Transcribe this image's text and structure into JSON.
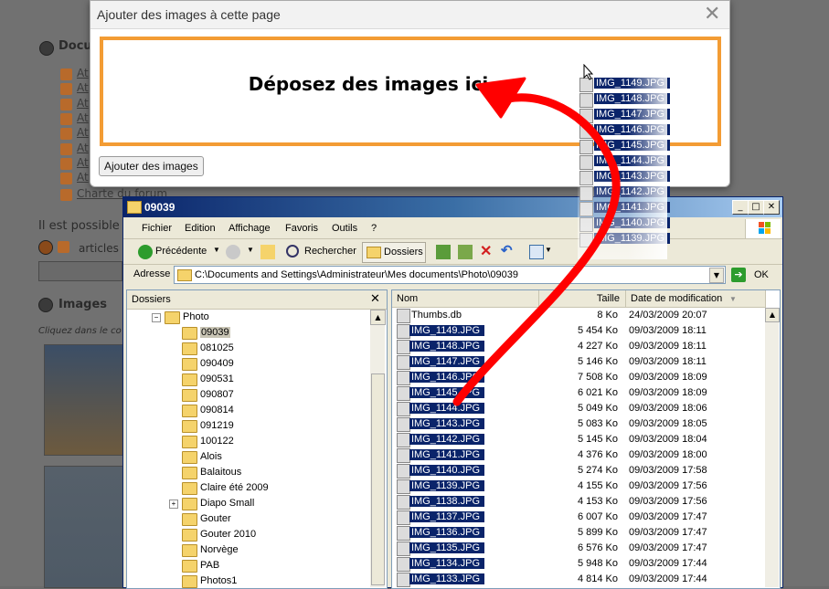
{
  "background": {
    "section_docs": "Docu",
    "doc_link_prefix": "At",
    "charte": "Charte du forum",
    "possible_text": "Il est possible",
    "articles": "articles",
    "images_title": "Images",
    "click_text": "Cliquez dans le co"
  },
  "dialog": {
    "title": "Ajouter des images à cette page",
    "close_glyph": "✕",
    "drop_text": "Déposez des images ici",
    "add_button": "Ajouter des images"
  },
  "explorer": {
    "title": "09039",
    "menu": [
      "Fichier",
      "Edition",
      "Affichage",
      "Favoris",
      "Outils",
      "?"
    ],
    "toolbar": {
      "back": "Précédente",
      "search": "Rechercher",
      "folders": "Dossiers"
    },
    "address_label": "Adresse",
    "address_value": "C:\\Documents and Settings\\Administrateur\\Mes documents\\Photo\\09039",
    "go_label": "OK",
    "folders_pane_title": "Dossiers",
    "folders_close": "✕",
    "tree": [
      {
        "label": "Photo",
        "expander": "−"
      },
      {
        "label": "09039",
        "selected": true
      },
      {
        "label": "081025"
      },
      {
        "label": "090409"
      },
      {
        "label": "090531"
      },
      {
        "label": "090807"
      },
      {
        "label": "090814"
      },
      {
        "label": "091219"
      },
      {
        "label": "100122"
      },
      {
        "label": "Alois"
      },
      {
        "label": "Balaitous"
      },
      {
        "label": "Claire été 2009"
      },
      {
        "label": "Diapo Small",
        "expander": "+"
      },
      {
        "label": "Gouter"
      },
      {
        "label": "Gouter 2010"
      },
      {
        "label": "Norvège"
      },
      {
        "label": "PAB"
      },
      {
        "label": "Photos1"
      }
    ],
    "columns": {
      "name": "Nom",
      "size": "Taille",
      "date": "Date de modification"
    },
    "files": [
      {
        "name": "Thumbs.db",
        "size": "8 Ko",
        "date": "24/03/2009 20:07",
        "selected": false
      },
      {
        "name": "IMG_1149.JPG",
        "size": "5 454 Ko",
        "date": "09/03/2009 18:11",
        "selected": true
      },
      {
        "name": "IMG_1148.JPG",
        "size": "4 227 Ko",
        "date": "09/03/2009 18:11",
        "selected": true
      },
      {
        "name": "IMG_1147.JPG",
        "size": "5 146 Ko",
        "date": "09/03/2009 18:11",
        "selected": true
      },
      {
        "name": "IMG_1146.JPG",
        "size": "7 508 Ko",
        "date": "09/03/2009 18:09",
        "selected": true
      },
      {
        "name": "IMG_1145.JPG",
        "size": "6 021 Ko",
        "date": "09/03/2009 18:09",
        "selected": true
      },
      {
        "name": "IMG_1144.JPG",
        "size": "5 049 Ko",
        "date": "09/03/2009 18:06",
        "selected": true
      },
      {
        "name": "IMG_1143.JPG",
        "size": "5 083 Ko",
        "date": "09/03/2009 18:05",
        "selected": true
      },
      {
        "name": "IMG_1142.JPG",
        "size": "5 145 Ko",
        "date": "09/03/2009 18:04",
        "selected": true
      },
      {
        "name": "IMG_1141.JPG",
        "size": "4 376 Ko",
        "date": "09/03/2009 18:00",
        "selected": true
      },
      {
        "name": "IMG_1140.JPG",
        "size": "5 274 Ko",
        "date": "09/03/2009 17:58",
        "selected": true
      },
      {
        "name": "IMG_1139.JPG",
        "size": "4 155 Ko",
        "date": "09/03/2009 17:56",
        "selected": true
      },
      {
        "name": "IMG_1138.JPG",
        "size": "4 153 Ko",
        "date": "09/03/2009 17:56",
        "selected": true
      },
      {
        "name": "IMG_1137.JPG",
        "size": "6 007 Ko",
        "date": "09/03/2009 17:47",
        "selected": true
      },
      {
        "name": "IMG_1136.JPG",
        "size": "5 899 Ko",
        "date": "09/03/2009 17:47",
        "selected": true
      },
      {
        "name": "IMG_1135.JPG",
        "size": "6 576 Ko",
        "date": "09/03/2009 17:47",
        "selected": true
      },
      {
        "name": "IMG_1134.JPG",
        "size": "5 948 Ko",
        "date": "09/03/2009 17:44",
        "selected": true
      },
      {
        "name": "IMG_1133.JPG",
        "size": "4 814 Ko",
        "date": "09/03/2009 17:44",
        "selected": true
      }
    ],
    "file_icon_text": "JPG"
  },
  "drag_ghost": [
    "IMG_1149.JPG",
    "IMG_1148.JPG",
    "IMG_1147.JPG",
    "IMG_1146.JPG",
    "IMG_1145.JPG",
    "IMG_1144.JPG",
    "IMG_1143.JPG",
    "IMG_1142.JPG",
    "IMG_1141.JPG",
    "IMG_1140.JPG",
    "IMG_1139.JPG"
  ],
  "colors": {
    "drop_border": "#f39c34",
    "arrow": "#ff0000",
    "selection": "#0a246a"
  }
}
